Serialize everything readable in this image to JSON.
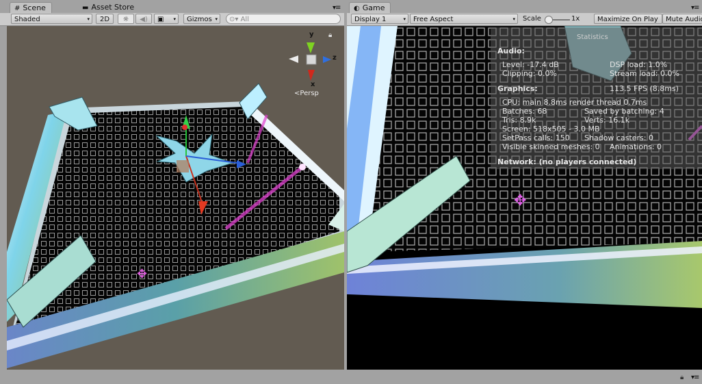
{
  "scene": {
    "tab_label": "Scene",
    "tab_icon": "#",
    "asset_store_label": "Asset Store",
    "shading_mode": "Shaded",
    "toggle_2d": "2D",
    "lighting_icon": "☼",
    "audio_icon": "◀)",
    "effects_icon": "▣",
    "gizmos_label": "Gizmos",
    "search_placeholder": "All",
    "gizmo": {
      "y": "y",
      "x": "x",
      "z": "z",
      "projection": "Persp"
    }
  },
  "game": {
    "tab_label": "Game",
    "tab_icon": "◐",
    "display": "Display 1",
    "aspect": "Free Aspect",
    "scale_label": "Scale",
    "scale_value": "1x",
    "maximize_label": "Maximize On Play",
    "mute_label": "Mute Audio"
  },
  "stats": {
    "title": "Statistics",
    "audio_header": "Audio:",
    "level": "Level: -17.4 dB",
    "dsp": "DSP load: 1.0%",
    "clipping": "Clipping: 0.0%",
    "stream": "Stream load: 0.0%",
    "graphics_header": "Graphics:",
    "fps": "113.5 FPS (8.8ms)",
    "cpu": "CPU: main 8.8ms  render thread 0.7ms",
    "batches": "Batches: 68",
    "saved": "Saved by batching: 4",
    "tris": "Tris: 8.9k",
    "verts": "Verts: 16.1k",
    "screen": "Screen: 518x505 - 3.0 MB",
    "setpass": "SetPass calls: 150",
    "shadow": "Shadow casters: 0",
    "skinned": "Visible skinned meshes: 0",
    "animations": "Animations: 0",
    "network": "Network: (no players connected)"
  }
}
